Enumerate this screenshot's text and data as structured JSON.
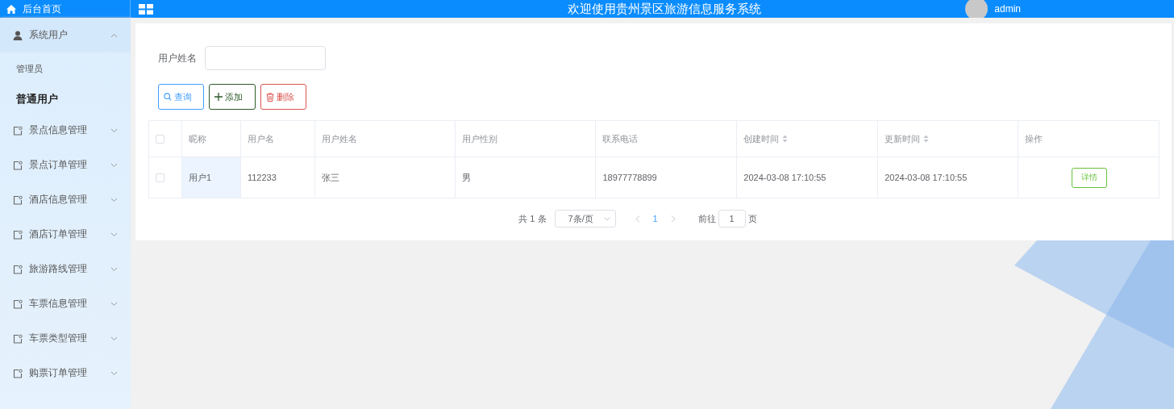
{
  "header": {
    "home_label": "后台首页",
    "title": "欢迎使用贵州景区旅游信息服务系统",
    "user": "admin"
  },
  "sidebar": {
    "items": [
      {
        "label": "系统用户",
        "kind": "user",
        "expanded": true,
        "children": [
          {
            "label": "管理员",
            "selected": false
          },
          {
            "label": "普通用户",
            "selected": true
          }
        ]
      },
      {
        "label": "景点信息管理",
        "kind": "module",
        "expanded": false
      },
      {
        "label": "景点订单管理",
        "kind": "module",
        "expanded": false
      },
      {
        "label": "酒店信息管理",
        "kind": "module",
        "expanded": false
      },
      {
        "label": "酒店订单管理",
        "kind": "module",
        "expanded": false
      },
      {
        "label": "旅游路线管理",
        "kind": "module",
        "expanded": false
      },
      {
        "label": "车票信息管理",
        "kind": "module",
        "expanded": false
      },
      {
        "label": "车票类型管理",
        "kind": "module",
        "expanded": false
      },
      {
        "label": "购票订单管理",
        "kind": "module",
        "expanded": false
      }
    ]
  },
  "search": {
    "label": "用户姓名"
  },
  "buttons": [
    {
      "label": "查询",
      "kind": "search"
    },
    {
      "label": "添加",
      "kind": "add"
    },
    {
      "label": "删除",
      "kind": "delete"
    }
  ],
  "table": {
    "all_checked": false,
    "columns": [
      {
        "label": "昵称",
        "sortable": false
      },
      {
        "label": "用户名",
        "sortable": false
      },
      {
        "label": "用户姓名",
        "sortable": false
      },
      {
        "label": "用户性别",
        "sortable": false
      },
      {
        "label": "联系电话",
        "sortable": false
      },
      {
        "label": "创建时间",
        "sortable": true
      },
      {
        "label": "更新时间",
        "sortable": true
      },
      {
        "label": "操作",
        "sortable": false
      }
    ],
    "rows": [
      {
        "checked": false,
        "cells": [
          {
            "text": "用户1",
            "highlighted": true
          },
          {
            "text": "112233",
            "highlighted": false
          },
          {
            "text": "张三",
            "highlighted": false
          },
          {
            "text": "男",
            "highlighted": false
          },
          {
            "text": "18977778899",
            "highlighted": false
          },
          {
            "text": "2024-03-08 17:10:55",
            "highlighted": false
          },
          {
            "text": "2024-03-08 17:10:55",
            "highlighted": false
          }
        ],
        "action": "详情"
      }
    ]
  },
  "pagination": {
    "total": "共 1 条",
    "page_size": "7条/页",
    "pages": [
      {
        "label": "1",
        "selected": true
      }
    ],
    "goto_label": "前往",
    "goto_value": "1",
    "goto_suffix": "页"
  }
}
